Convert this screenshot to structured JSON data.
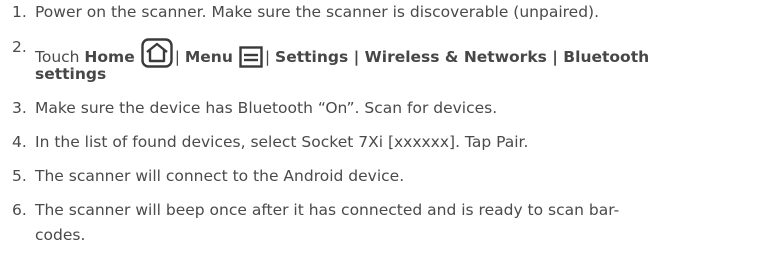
{
  "steps": [
    {
      "num": "1.",
      "text": "Power on the scanner. Make sure the scanner is discoverable (unpaired)."
    },
    {
      "num": "2.",
      "prefix": "Touch ",
      "home": "Home",
      "sep1": "| ",
      "menu": "Menu",
      "sep2": "| ",
      "path": "Settings | Wireless & Networks | Bluetooth",
      "path_cont": "settings"
    },
    {
      "num": "3.",
      "text": "Make sure the device has Bluetooth “On”. Scan for devices."
    },
    {
      "num": "4.",
      "text": "In the list of found devices, select Socket 7Xi [xxxxxx]. Tap Pair."
    },
    {
      "num": "5.",
      "text": "The scanner will connect to the Android device."
    },
    {
      "num": "6.",
      "text": "The scanner will beep once after it has connected and is ready to scan bar-",
      "text_cont": "codes."
    }
  ],
  "icons": {
    "home": "home-icon",
    "menu": "menu-icon"
  }
}
